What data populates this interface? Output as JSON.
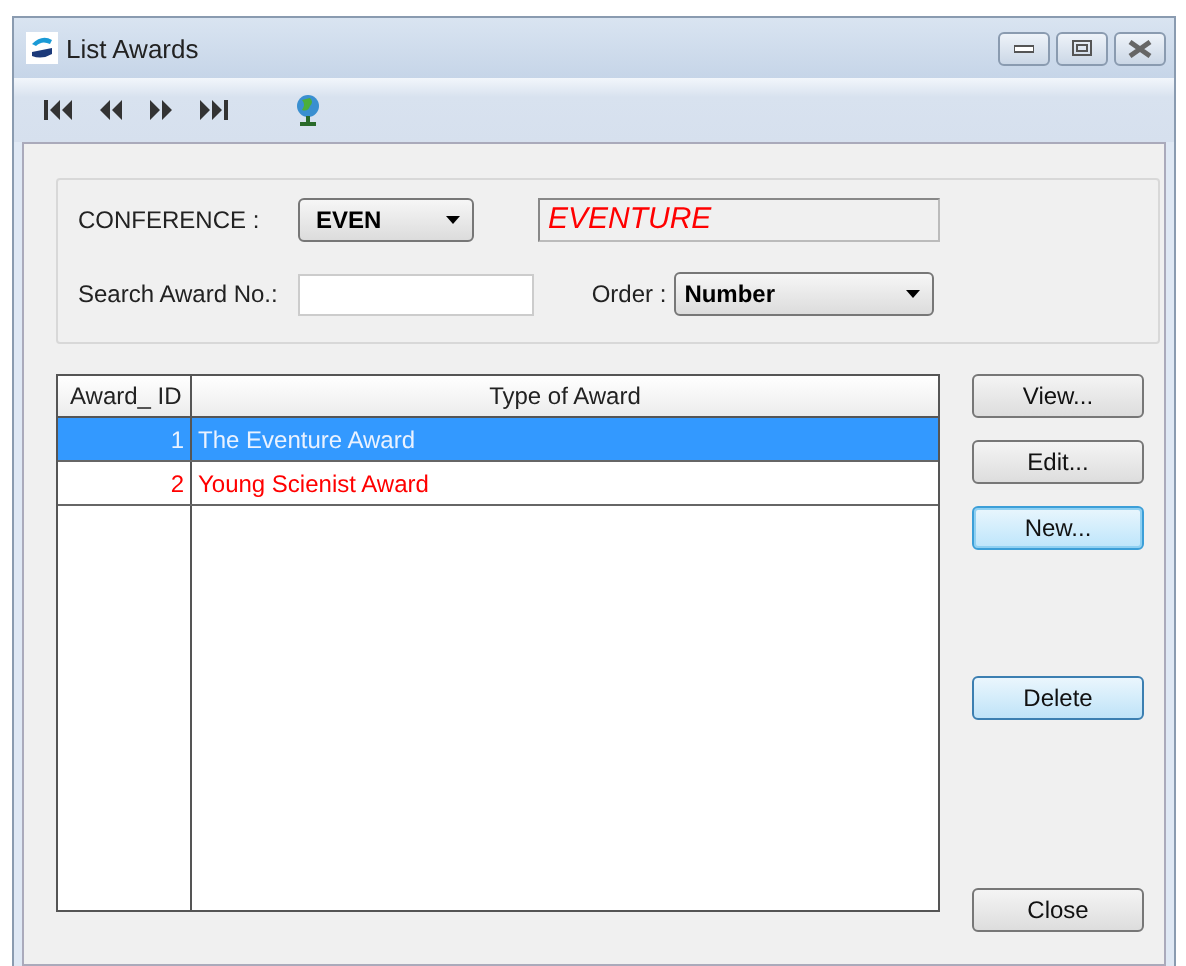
{
  "window": {
    "title": "List Awards"
  },
  "toolbar": [
    {
      "kind": "first"
    },
    {
      "kind": "prev"
    },
    {
      "kind": "next"
    },
    {
      "kind": "last"
    },
    {
      "kind": "globe"
    }
  ],
  "conference": {
    "label": "CONFERENCE :",
    "value": "EVEN",
    "name": "EVENTURE"
  },
  "search": {
    "label": "Search Award No.:"
  },
  "order": {
    "label": "Order :",
    "value": "Number"
  },
  "table": {
    "columns": [
      "Award_ ID",
      "Type of Award"
    ],
    "rows": [
      {
        "id": "1",
        "type": "The Eventure Award",
        "selected": true,
        "flagged": false
      },
      {
        "id": "2",
        "type": "Young Scienist Award",
        "selected": false,
        "flagged": true
      }
    ]
  },
  "buttons": [
    {
      "label": "View...",
      "kind": "default"
    },
    {
      "label": "Edit...",
      "kind": "default"
    },
    {
      "label": "New...",
      "kind": "focused"
    },
    {
      "label": "Delete",
      "kind": "hot"
    },
    {
      "label": "Close",
      "kind": "default"
    }
  ]
}
